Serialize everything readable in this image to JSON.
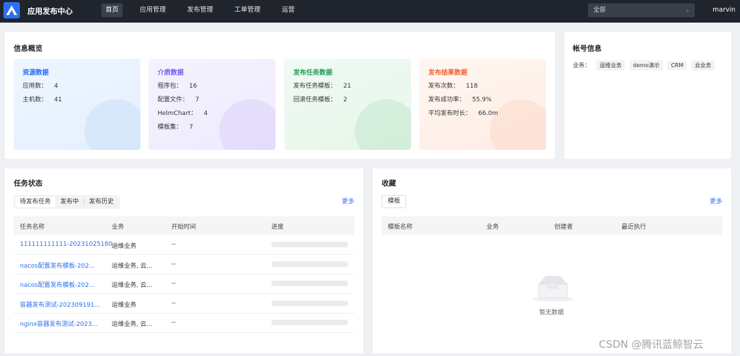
{
  "app": {
    "title": "应用发布中心",
    "user": "marvin",
    "scope": "全部"
  },
  "nav": [
    {
      "label": "首页",
      "active": true
    },
    {
      "label": "应用管理"
    },
    {
      "label": "发布管理"
    },
    {
      "label": "工单管理"
    },
    {
      "label": "运营"
    }
  ],
  "overview": {
    "title": "信息概览",
    "cards": [
      {
        "title": "资源数据",
        "rows": [
          {
            "k": "应用数：",
            "v": "4"
          },
          {
            "k": "主机数：",
            "v": "41"
          }
        ]
      },
      {
        "title": "介质数据",
        "rows": [
          {
            "k": "程序包：",
            "v": "16"
          },
          {
            "k": "配置文件：",
            "v": "7"
          },
          {
            "k": "HelmChart：",
            "v": "4"
          },
          {
            "k": "模板集：",
            "v": "7"
          }
        ]
      },
      {
        "title": "发布任务数据",
        "rows": [
          {
            "k": "发布任务模板：",
            "v": "21"
          },
          {
            "k": "回滚任务模板：",
            "v": "2"
          }
        ]
      },
      {
        "title": "发布结果数据",
        "rows": [
          {
            "k": "发布次数：",
            "v": "118"
          },
          {
            "k": "发布成功率：",
            "v": "55.9%"
          },
          {
            "k": "平均发布时长：",
            "v": "66.0m"
          }
        ]
      }
    ]
  },
  "account": {
    "title": "帐号信息",
    "biz_label": "业务：",
    "tags": [
      "运维业务",
      "demo演示",
      "CRM",
      "云业务"
    ]
  },
  "tasks": {
    "title": "任务状态",
    "tabs": [
      "待发布任务",
      "发布中",
      "发布历史"
    ],
    "more": "更多",
    "columns": [
      "任务名称",
      "业务",
      "开始时间",
      "进度"
    ],
    "rows": [
      {
        "name": "111111111111-20231025180...",
        "biz": "运维业务",
        "start": "--",
        "progress": 0
      },
      {
        "name": "nacos配置发布模板-202...",
        "biz": "运维业务, 云...",
        "start": "--",
        "progress": 0
      },
      {
        "name": "nacos配置发布模板-202...",
        "biz": "运维业务, 云...",
        "start": "--",
        "progress": 0
      },
      {
        "name": "容器发布测试-202309191...",
        "biz": "运维业务",
        "start": "--",
        "progress": 0
      },
      {
        "name": "nginx容器发布测试-2023...",
        "biz": "运维业务, 云...",
        "start": "--",
        "progress": 0
      }
    ]
  },
  "favorites": {
    "title": "收藏",
    "chip": "模板",
    "more": "更多",
    "columns": [
      "模板名称",
      "业务",
      "创建者",
      "最近执行"
    ],
    "empty": "暂无数据"
  },
  "watermark": "CSDN @腾讯蓝鲸智云"
}
